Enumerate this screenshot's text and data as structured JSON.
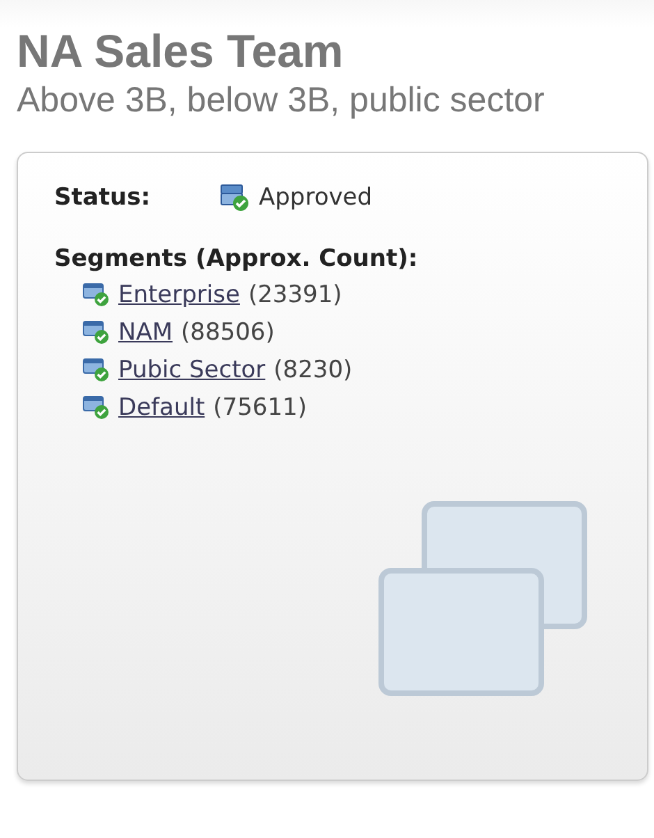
{
  "title": "NA Sales Team",
  "subtitle": "Above 3B, below 3B, public sector",
  "status": {
    "label": "Status:",
    "value": "Approved"
  },
  "segments": {
    "heading": "Segments (Approx. Count):",
    "items": [
      {
        "name": "Enterprise",
        "count": "(23391)"
      },
      {
        "name": "NAM",
        "count": "(88506)"
      },
      {
        "name": "Pubic Sector",
        "count": "(8230)"
      },
      {
        "name": "Default",
        "count": "(75611)"
      }
    ]
  }
}
